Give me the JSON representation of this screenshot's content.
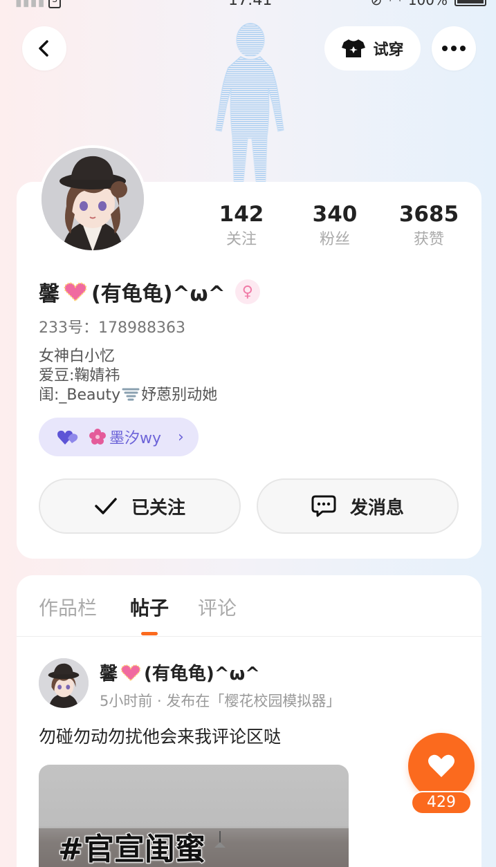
{
  "status_bar": {
    "time": "17:41",
    "battery": "100%",
    "icons": [
      "signal-icon",
      "sim-icon",
      "mute-icon",
      "wifi-icon",
      "battery-icon"
    ]
  },
  "header": {
    "try_on_label": "试穿",
    "icons": {
      "back": "chevron-left-icon",
      "try_on": "tshirt-icon",
      "more": "more-dots-icon"
    }
  },
  "profile": {
    "username_prefix": "馨",
    "username_suffix": "(有龟龟)^ω^",
    "gender": "♀",
    "uid_label": "233号：",
    "uid": "178988363",
    "bio_lines": [
      "女神白小忆",
      "爱豆:鞠婧祎",
      "闺:_Beauty",
      "妤蒽别动她"
    ],
    "stats": [
      {
        "value": "142",
        "label": "关注"
      },
      {
        "value": "340",
        "label": "粉丝"
      },
      {
        "value": "3685",
        "label": "获赞"
      }
    ],
    "cp": {
      "name": "墨汐wy"
    },
    "follow_label": "已关注",
    "message_label": "发消息"
  },
  "tabs": [
    {
      "label": "作品栏",
      "active": false
    },
    {
      "label": "帖子",
      "active": true
    },
    {
      "label": "评论",
      "active": false
    }
  ],
  "post": {
    "author_prefix": "馨",
    "author_suffix": "(有龟龟)^ω^",
    "meta": "5小时前 · 发布在「樱花校园模拟器」",
    "text": "勿碰勿动勿扰他会来我评论区哒",
    "image_caption": "#官宣闺蜜",
    "likes": "429"
  },
  "colors": {
    "accent_orange": "#fb6a1e",
    "cp_purple": "#6c63d8",
    "cp_bg": "#e8e6fb",
    "gender_pink": "#f07aa6"
  }
}
